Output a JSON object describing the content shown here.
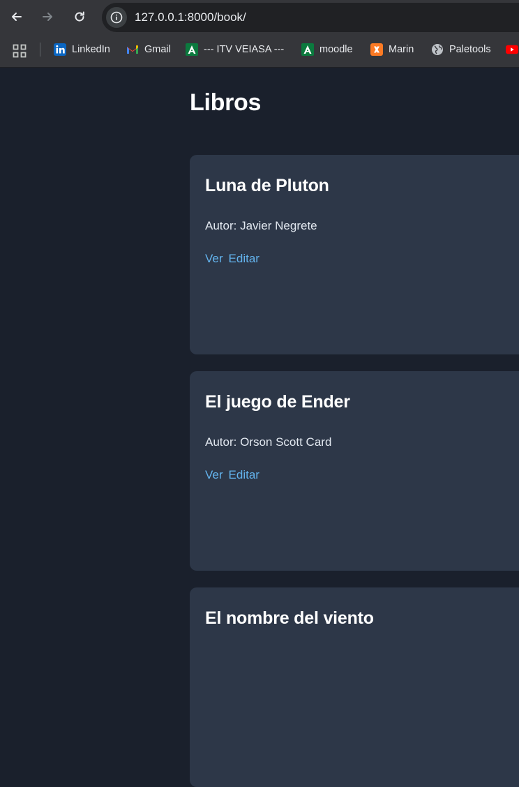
{
  "browser": {
    "url": "127.0.0.1:8000/book/",
    "bookmarks": [
      {
        "label": "LinkedIn",
        "icon": "linkedin-icon",
        "color": "#0a66c2"
      },
      {
        "label": "Gmail",
        "icon": "gmail-icon",
        "color": "#ea4335"
      },
      {
        "label": "--- ITV VEIASA ---",
        "icon": "andalucia-icon",
        "color": "#0b7a3e"
      },
      {
        "label": "moodle",
        "icon": "andalucia-icon",
        "color": "#0b7a3e"
      },
      {
        "label": "Marin",
        "icon": "xampp-icon",
        "color": "#fb7a24"
      },
      {
        "label": "Paletools",
        "icon": "globe-icon",
        "color": "#bdc1c6"
      },
      {
        "label": "",
        "icon": "youtube-icon",
        "color": "#ff0000"
      }
    ]
  },
  "page": {
    "title": "Libros",
    "books": [
      {
        "title": "Luna de Pluton",
        "author": "Autor: Javier Negrete",
        "view": "Ver",
        "edit": "Editar"
      },
      {
        "title": "El juego de Ender",
        "author": "Autor: Orson Scott Card",
        "view": "Ver",
        "edit": "Editar"
      },
      {
        "title": "El nombre del viento",
        "author": "",
        "view": "",
        "edit": ""
      }
    ]
  },
  "colors": {
    "background": "#1a202c",
    "card": "#2d3748",
    "link": "#63b3ed"
  }
}
